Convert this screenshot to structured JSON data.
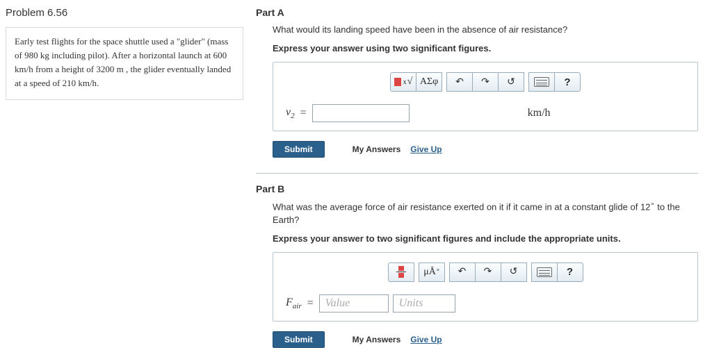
{
  "problem": {
    "title": "Problem 6.56",
    "context_html": "Early test flights for the space shuttle used a \"glider\" (mass of 980 kg including pilot). After a horizontal launch at 600 km/h from a height of 3200 m , the glider eventually landed at a speed of 210 km/h."
  },
  "partA": {
    "title": "Part A",
    "question": "What would its landing speed have been in the absence of air resistance?",
    "instruction": "Express your answer using two significant figures.",
    "var": "v",
    "var_sub": "2",
    "unit": "km/h",
    "toolbar": {
      "sqrt": "x√",
      "greek": "ΑΣφ",
      "help": "?"
    }
  },
  "partB": {
    "title": "Part B",
    "question": "What was the average force of air resistance exerted on it if it came in at a constant glide of 12° to the Earth?",
    "instruction": "Express your answer to two significant figures and include the appropriate units.",
    "var": "F",
    "var_sub": "air",
    "value_placeholder": "Value",
    "units_placeholder": "Units",
    "toolbar": {
      "units": "μÅ",
      "help": "?"
    }
  },
  "actions": {
    "submit": "Submit",
    "my_answers": "My Answers",
    "give_up": "Give Up"
  }
}
